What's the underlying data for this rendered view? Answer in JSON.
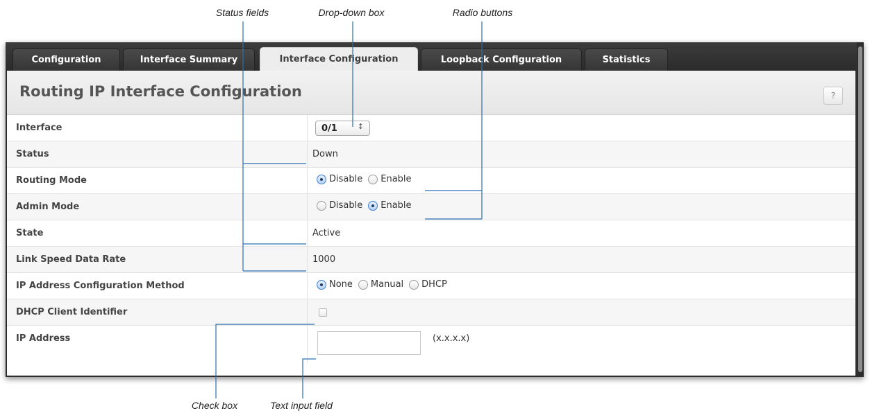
{
  "callouts": {
    "status_fields": "Status fields",
    "drop_down_box": "Drop-down box",
    "radio_buttons": "Radio buttons",
    "check_box": "Check box",
    "text_input_field": "Text input field"
  },
  "tabs": [
    {
      "label": "Configuration",
      "active": false
    },
    {
      "label": "Interface Summary",
      "active": false
    },
    {
      "label": "Interface Configuration",
      "active": true
    },
    {
      "label": "Loopback Configuration",
      "active": false
    },
    {
      "label": "Statistics",
      "active": false
    }
  ],
  "panel": {
    "title": "Routing IP Interface Configuration",
    "help_label": "?"
  },
  "rows": {
    "interface": {
      "label": "Interface",
      "value": "0/1",
      "arrows": "↕"
    },
    "status": {
      "label": "Status",
      "value": "Down"
    },
    "routing_mode": {
      "label": "Routing Mode",
      "options": [
        "Disable",
        "Enable"
      ],
      "selected": "Disable"
    },
    "admin_mode": {
      "label": "Admin Mode",
      "options": [
        "Disable",
        "Enable"
      ],
      "selected": "Enable"
    },
    "state": {
      "label": "State",
      "value": "Active"
    },
    "link_speed": {
      "label": "Link Speed Data Rate",
      "value": "1000"
    },
    "ip_method": {
      "label": "IP Address Configuration Method",
      "options": [
        "None",
        "Manual",
        "DHCP"
      ],
      "selected": "None"
    },
    "dhcp_client_id": {
      "label": "DHCP Client Identifier",
      "checked": false
    },
    "ip_address": {
      "label": "IP Address",
      "value": "",
      "hint": "(x.x.x.x)"
    }
  },
  "colors": {
    "callout_line": "#2a6fb0",
    "tab_bar": "#2e2e2e",
    "radio_checked": "#3d7fcf"
  }
}
